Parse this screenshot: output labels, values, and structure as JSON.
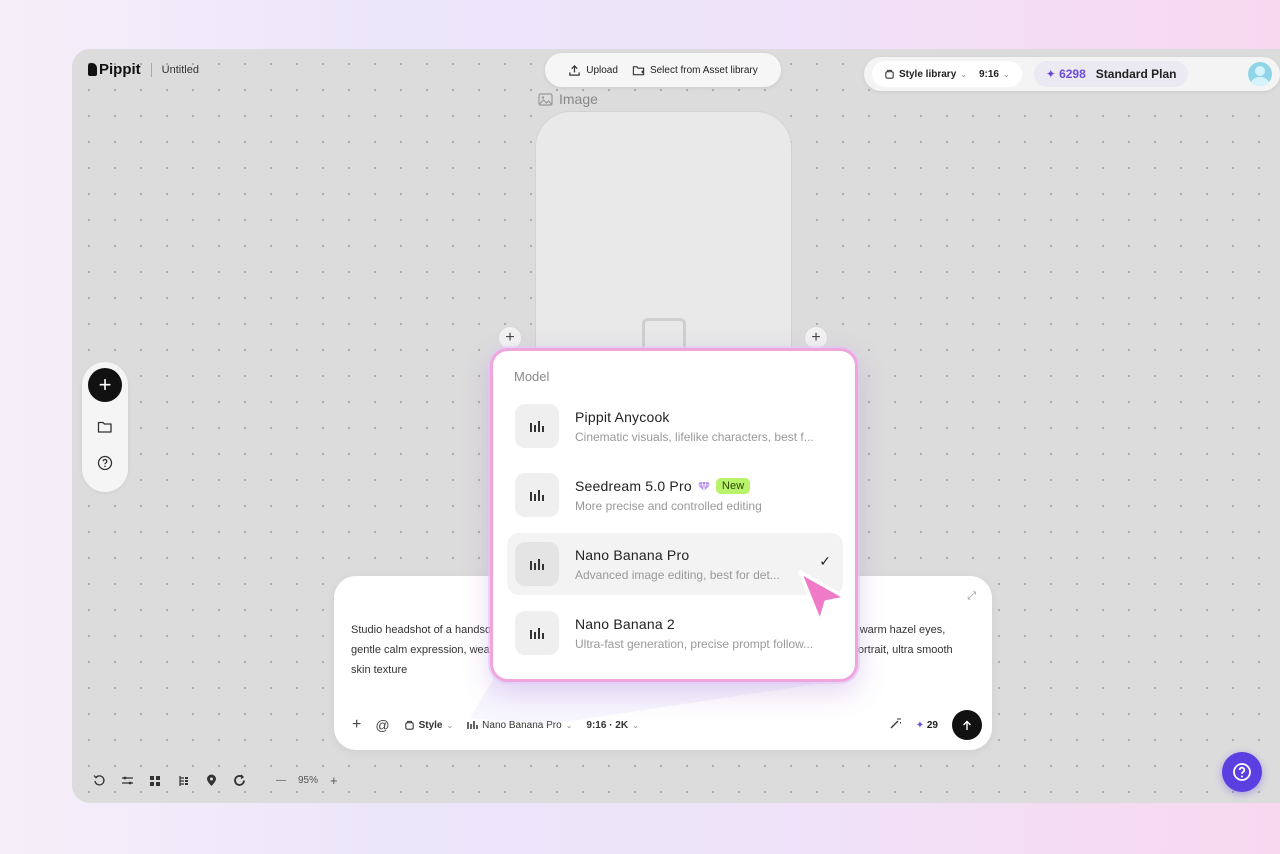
{
  "header": {
    "logo": "Pippit",
    "doc_title": "Untitled"
  },
  "upload_bar": {
    "upload_label": "Upload",
    "asset_label": "Select from Asset library"
  },
  "top_right": {
    "style_library_label": "Style library",
    "ratio_label": "9:16",
    "credits": "6298",
    "plan": "Standard Plan"
  },
  "canvas": {
    "image_label": "Image"
  },
  "model_menu": {
    "title": "Model",
    "items": [
      {
        "name": "Pippit Anycook",
        "desc": "Cinematic visuals, lifelike characters, best f...",
        "badge": "",
        "selected": false
      },
      {
        "name": "Seedream 5.0 Pro",
        "desc": "More precise and controlled editing",
        "badge": "New",
        "selected": false
      },
      {
        "name": "Nano Banana Pro",
        "desc": "Advanced image editing, best for det...",
        "badge": "",
        "selected": true
      },
      {
        "name": "Nano Banana 2",
        "desc": "Ultra-fast generation, precise prompt follow...",
        "badge": "",
        "selected": false
      }
    ]
  },
  "prompt": {
    "text": "Studio headshot of a handsome man in his late thirties with short salt-and-pepper hair, soft grey stubble, warm hazel eyes, gentle calm expression, wearing a navy blazer, neutral backdrop, soft ring light, professional magazine portrait, ultra smooth skin texture",
    "style_label": "Style",
    "model_label": "Nano Banana Pro",
    "ratio_quality": "9:16 · 2K",
    "cost": "29"
  },
  "bottom_bar": {
    "zoom": "95%",
    "zoom_minus": "—",
    "zoom_plus": "+"
  },
  "colors": {
    "accent": "#6c4bd8",
    "help_fab": "#5b3fe0",
    "new_badge": "#b9f26b",
    "panel_border": "#f0a6dc",
    "cursor": "#ef7ac6"
  }
}
